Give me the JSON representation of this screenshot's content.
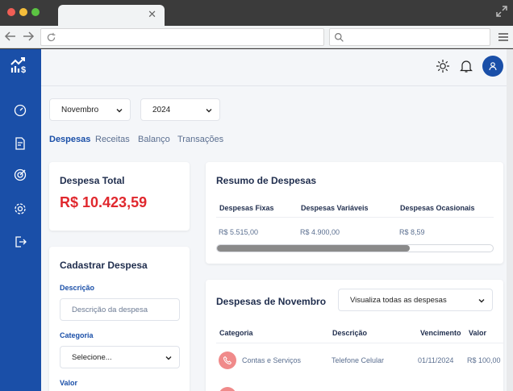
{
  "browser": {
    "tab_close": "✕"
  },
  "header": {
    "icons": [
      "sun-icon",
      "bell-icon",
      "user-icon"
    ]
  },
  "filters": {
    "month": "Novembro",
    "year": "2024"
  },
  "tabs": [
    "Despesas",
    "Receitas",
    "Balanço",
    "Transações"
  ],
  "total_card": {
    "title": "Despesa Total",
    "value": "R$ 10.423,59"
  },
  "form": {
    "title": "Cadastrar Despesa",
    "description_label": "Descrição",
    "description_placeholder": "Descrição da despesa",
    "category_label": "Categoria",
    "category_value": "Selecione...",
    "value_label": "Valor"
  },
  "summary": {
    "title": "Resumo de Despesas",
    "headers": [
      "Despesas Fixas",
      "Despesas Variáveis",
      "Despesas Ocasionais"
    ],
    "values": [
      "R$ 5.515,00",
      "R$ 4.900,00",
      "R$ 8,59"
    ],
    "progress_fraction": 0.7
  },
  "month_expenses": {
    "title": "Despesas de Novembro",
    "filter_value": "Visualiza todas as despesas",
    "headers": [
      "Categoria",
      "Descrição",
      "Vencimento",
      "Valor"
    ],
    "rows": [
      {
        "category": "Contas e Serviços",
        "description": "Telefone Celular",
        "due": "01/11/2024",
        "value": "R$ 100,00"
      }
    ]
  },
  "colors": {
    "primary": "#1a4fa8",
    "danger": "#e0282e",
    "category_icon": "#f08a8a"
  }
}
